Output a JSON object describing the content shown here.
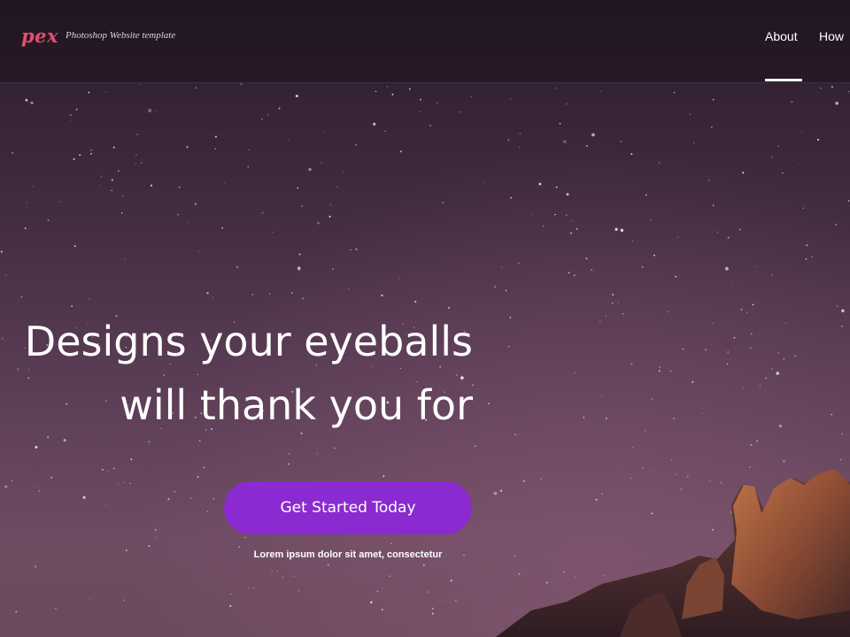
{
  "header": {
    "logo": "pex",
    "tagline": "Photoshop Website template",
    "nav": [
      {
        "label": "About",
        "active": true
      },
      {
        "label": "How",
        "active": false
      }
    ]
  },
  "hero": {
    "headline_line1": "Designs your eyeballs",
    "headline_line2": "will thank you for",
    "cta_label": "Get Started Today",
    "subtext": "Lorem ipsum dolor sit amet, consectetur"
  },
  "colors": {
    "accent": "#8b2ad0",
    "logo": "#e0506e"
  }
}
